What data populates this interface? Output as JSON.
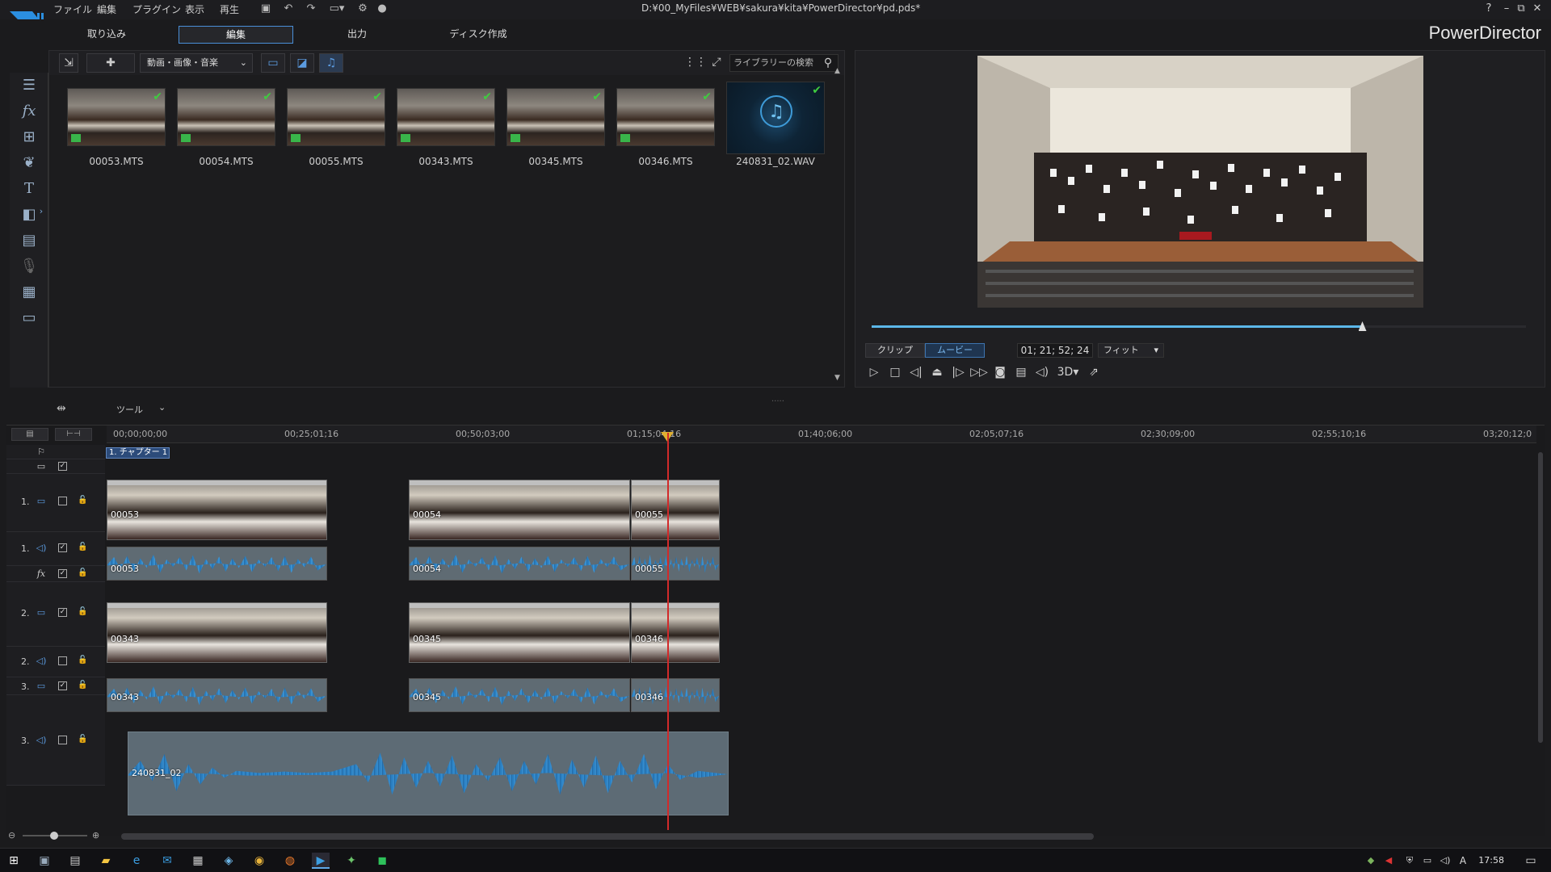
{
  "titlebar": {
    "menu": [
      "ファイル",
      "編集",
      "プラグイン",
      "表示",
      "再生"
    ],
    "filepath": "D:¥00_MyFiles¥WEB¥sakura¥kita¥PowerDirector¥pd.pds*",
    "help": "?",
    "minimize": "–",
    "restore": "⧉",
    "close": "✕"
  },
  "mode_tabs": [
    "取り込み",
    "編集",
    "出力",
    "ディスク作成"
  ],
  "app_name": "PowerDirector",
  "library": {
    "filter": "動画・画像・音楽",
    "search_placeholder": "ライブラリーの検索",
    "items": [
      {
        "name": "00053.MTS",
        "type": "video"
      },
      {
        "name": "00054.MTS",
        "type": "video"
      },
      {
        "name": "00055.MTS",
        "type": "video"
      },
      {
        "name": "00343.MTS",
        "type": "video"
      },
      {
        "name": "00345.MTS",
        "type": "video"
      },
      {
        "name": "00346.MTS",
        "type": "video"
      },
      {
        "name": "240831_02.WAV",
        "type": "audio"
      }
    ]
  },
  "preview": {
    "tab_clip": "クリップ",
    "tab_movie": "ムービー",
    "timecode": "01; 21; 52; 24",
    "fit": "フィット",
    "threed": "3D",
    "progress_fraction": 0.75
  },
  "timeline_toolbar": {
    "tools": "ツール"
  },
  "ruler": [
    "00;00;00;00",
    "00;25;01;16",
    "00;50;03;00",
    "01;15;04;16",
    "01;40;06;00",
    "02;05;07;16",
    "02;30;09;00",
    "02;55;10;16",
    "03;20;12;0"
  ],
  "chapter": "1. チャプター 1",
  "tracks": {
    "t1v": {
      "num": "1.",
      "clips": [
        "00053",
        "00054",
        "00055"
      ]
    },
    "t1a": {
      "num": "1.",
      "clips": [
        "00053",
        "00054",
        "00055"
      ]
    },
    "t2v": {
      "num": "2.",
      "clips": [
        "00343",
        "00345",
        "00346"
      ]
    },
    "t2a": {
      "num": "2.",
      "clips": [
        "00343",
        "00345",
        "00346"
      ]
    },
    "t3v": {
      "num": "3."
    },
    "t3a": {
      "num": "3.",
      "clips": [
        "240831_02"
      ]
    }
  },
  "fx_label": "fx",
  "clock": "17:58"
}
